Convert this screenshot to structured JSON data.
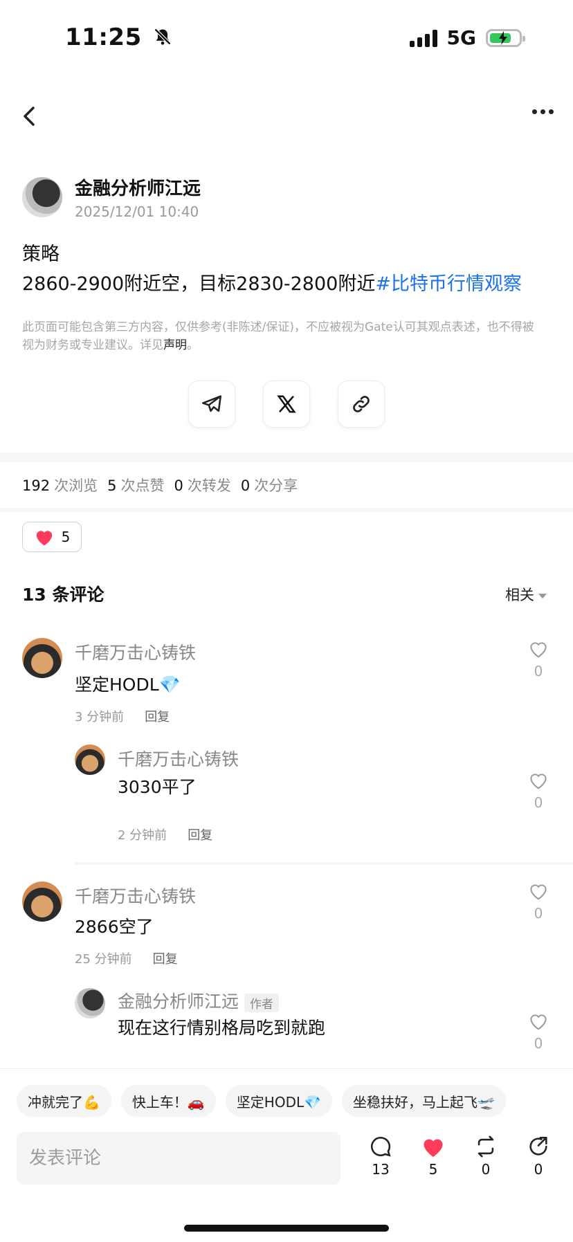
{
  "status_bar": {
    "time": "11:25",
    "network": "5G"
  },
  "post": {
    "author": "金融分析师江远",
    "timestamp": "2025/12/01 10:40",
    "line1": "策略",
    "line2": "2860-2900附近空，目标2830-2800附近",
    "hashtag": "#比特币行情观察",
    "disclaimer": "此页面可能包含第三方内容，仅供参考(非陈述/保证)，不应被视为Gate认可其观点表述，也不得被视为财务或专业建议。详见",
    "disclaimer_link": "声明",
    "disclaimer_end": "。"
  },
  "share": {
    "icons": [
      "telegram-icon",
      "x-icon",
      "link-icon"
    ]
  },
  "stats": {
    "views": "192",
    "views_label": "次浏览",
    "likes": "5",
    "likes_label": "次点赞",
    "reposts": "0",
    "reposts_label": "次转发",
    "shares": "0",
    "shares_label": "次分享"
  },
  "like_pill": {
    "count": "5"
  },
  "comments": {
    "title": "13 条评论",
    "sort": "相关",
    "reply_label": "回复",
    "author_tag": "作者",
    "items": [
      {
        "name": "千磨万击心铸铁",
        "text": "坚定HODL💎",
        "time": "3 分钟前",
        "likes": "0"
      },
      {
        "name": "千磨万击心铸铁",
        "text": "3030平了",
        "time": "2 分钟前",
        "likes": "0"
      },
      {
        "name": "千磨万击心铸铁",
        "text": "2866空了",
        "time": "25 分钟前",
        "likes": "0"
      },
      {
        "name": "金融分析师江远",
        "text": "现在这行情别格局吃到就跑",
        "likes": "0"
      }
    ]
  },
  "quick_replies": [
    "冲就完了💪",
    "快上车！🚗",
    "坚定HODL💎",
    "坐稳扶好，马上起飞🛫"
  ],
  "bottom_bar": {
    "input_placeholder": "发表评论",
    "comments_count": "13",
    "likes_count": "5",
    "reposts_count": "0",
    "shares_count": "0"
  },
  "colors": {
    "accent_link": "#1a73e8",
    "heart": "#ff3b5c",
    "battery": "#34c759"
  }
}
